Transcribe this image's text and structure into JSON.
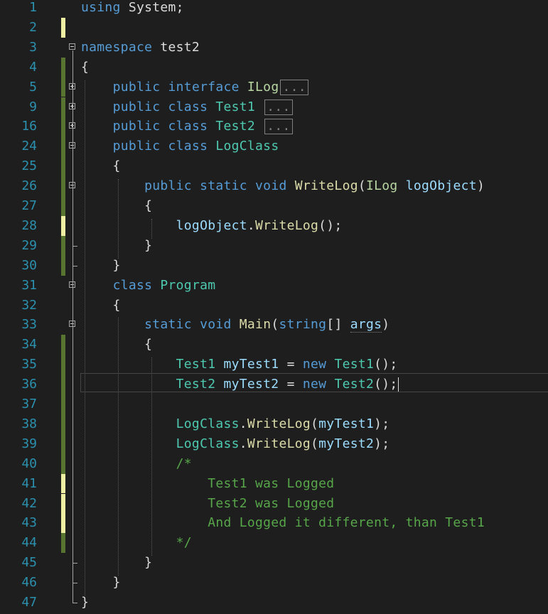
{
  "lines": [
    {
      "n": "1",
      "tokens": [
        [
          "kw",
          "using"
        ],
        [
          "pr",
          " System;"
        ]
      ]
    },
    {
      "n": "2",
      "tokens": []
    },
    {
      "n": "3",
      "tokens": [
        [
          "kw",
          "namespace"
        ],
        [
          "pr",
          " test2"
        ]
      ]
    },
    {
      "n": "4",
      "tokens": [
        [
          "pr",
          "{"
        ]
      ]
    },
    {
      "n": "5",
      "tokens": [
        [
          "pr",
          "    "
        ],
        [
          "kw",
          "public"
        ],
        [
          "pr",
          " "
        ],
        [
          "kw",
          "interface"
        ],
        [
          "pr",
          " "
        ],
        [
          "ty-i",
          "ILog"
        ]
      ],
      "collapsed": "..."
    },
    {
      "n": "9",
      "tokens": [
        [
          "pr",
          "    "
        ],
        [
          "kw",
          "public"
        ],
        [
          "pr",
          " "
        ],
        [
          "kw",
          "class"
        ],
        [
          "pr",
          " "
        ],
        [
          "ty",
          "Test1"
        ],
        [
          "pr",
          " "
        ]
      ],
      "collapsed": "..."
    },
    {
      "n": "16",
      "tokens": [
        [
          "pr",
          "    "
        ],
        [
          "kw",
          "public"
        ],
        [
          "pr",
          " "
        ],
        [
          "kw",
          "class"
        ],
        [
          "pr",
          " "
        ],
        [
          "ty",
          "Test2"
        ],
        [
          "pr",
          " "
        ]
      ],
      "collapsed": "..."
    },
    {
      "n": "24",
      "tokens": [
        [
          "pr",
          "    "
        ],
        [
          "kw",
          "public"
        ],
        [
          "pr",
          " "
        ],
        [
          "kw",
          "class"
        ],
        [
          "pr",
          " "
        ],
        [
          "ty",
          "LogClass"
        ]
      ]
    },
    {
      "n": "25",
      "tokens": [
        [
          "pr",
          "    {"
        ]
      ]
    },
    {
      "n": "26",
      "tokens": [
        [
          "pr",
          "        "
        ],
        [
          "kw",
          "public"
        ],
        [
          "pr",
          " "
        ],
        [
          "kw",
          "static"
        ],
        [
          "pr",
          " "
        ],
        [
          "kw",
          "void"
        ],
        [
          "pr",
          " "
        ],
        [
          "fn",
          "WriteLog"
        ],
        [
          "pr",
          "("
        ],
        [
          "ty-i",
          "ILog"
        ],
        [
          "pr",
          " "
        ],
        [
          "va",
          "logObject"
        ],
        [
          "pr",
          ")"
        ]
      ]
    },
    {
      "n": "27",
      "tokens": [
        [
          "pr",
          "        {"
        ]
      ]
    },
    {
      "n": "28",
      "tokens": [
        [
          "pr",
          "            "
        ],
        [
          "va",
          "logObject"
        ],
        [
          "pr",
          "."
        ],
        [
          "fn",
          "WriteLog"
        ],
        [
          "pr",
          "();"
        ]
      ]
    },
    {
      "n": "29",
      "tokens": [
        [
          "pr",
          "        }"
        ]
      ]
    },
    {
      "n": "30",
      "tokens": [
        [
          "pr",
          "    }"
        ]
      ]
    },
    {
      "n": "31",
      "tokens": [
        [
          "pr",
          "    "
        ],
        [
          "kw",
          "class"
        ],
        [
          "pr",
          " "
        ],
        [
          "ty",
          "Program"
        ]
      ]
    },
    {
      "n": "32",
      "tokens": [
        [
          "pr",
          "    {"
        ]
      ]
    },
    {
      "n": "33",
      "tokens": [
        [
          "pr",
          "        "
        ],
        [
          "kw",
          "static"
        ],
        [
          "pr",
          " "
        ],
        [
          "kw",
          "void"
        ],
        [
          "pr",
          " "
        ],
        [
          "fn",
          "Main"
        ],
        [
          "pr",
          "("
        ],
        [
          "kw",
          "string"
        ],
        [
          "pr",
          "[] "
        ],
        [
          "va squig",
          "args"
        ],
        [
          "pr",
          ")"
        ]
      ]
    },
    {
      "n": "34",
      "tokens": [
        [
          "pr",
          "        {"
        ]
      ]
    },
    {
      "n": "35",
      "tokens": [
        [
          "pr",
          "            "
        ],
        [
          "ty",
          "Test1"
        ],
        [
          "pr",
          " "
        ],
        [
          "va",
          "myTest1"
        ],
        [
          "pr",
          " = "
        ],
        [
          "kw",
          "new"
        ],
        [
          "pr",
          " "
        ],
        [
          "ty",
          "Test1"
        ],
        [
          "pr",
          "();"
        ]
      ]
    },
    {
      "n": "36",
      "tokens": [
        [
          "pr",
          "            "
        ],
        [
          "ty",
          "Test2"
        ],
        [
          "pr",
          " "
        ],
        [
          "va",
          "myTest2"
        ],
        [
          "pr",
          " = "
        ],
        [
          "kw",
          "new"
        ],
        [
          "pr",
          " "
        ],
        [
          "ty",
          "Test2"
        ],
        [
          "pr",
          "();"
        ]
      ],
      "caret": true
    },
    {
      "n": "37",
      "tokens": []
    },
    {
      "n": "38",
      "tokens": [
        [
          "pr",
          "            "
        ],
        [
          "ty",
          "LogClass"
        ],
        [
          "pr",
          "."
        ],
        [
          "fn",
          "WriteLog"
        ],
        [
          "pr",
          "("
        ],
        [
          "va",
          "myTest1"
        ],
        [
          "pr",
          ");"
        ]
      ]
    },
    {
      "n": "39",
      "tokens": [
        [
          "pr",
          "            "
        ],
        [
          "ty",
          "LogClass"
        ],
        [
          "pr",
          "."
        ],
        [
          "fn",
          "WriteLog"
        ],
        [
          "pr",
          "("
        ],
        [
          "va",
          "myTest2"
        ],
        [
          "pr",
          ");"
        ]
      ]
    },
    {
      "n": "40",
      "tokens": [
        [
          "pr",
          "            "
        ],
        [
          "cm",
          "/*"
        ]
      ]
    },
    {
      "n": "41",
      "tokens": [
        [
          "cm",
          "                Test1 was Logged"
        ]
      ]
    },
    {
      "n": "42",
      "tokens": [
        [
          "cm",
          "                Test2 was Logged"
        ]
      ]
    },
    {
      "n": "43",
      "tokens": [
        [
          "cm",
          "                And Logged it different, than Test1"
        ]
      ]
    },
    {
      "n": "44",
      "tokens": [
        [
          "cm",
          "            */"
        ]
      ]
    },
    {
      "n": "45",
      "tokens": [
        [
          "pr",
          "        }"
        ]
      ]
    },
    {
      "n": "46",
      "tokens": [
        [
          "pr",
          "    }"
        ]
      ]
    },
    {
      "n": "47",
      "tokens": [
        [
          "pr",
          "}"
        ]
      ]
    }
  ],
  "colors": {
    "background": "#1e1e1e",
    "line_number": "#2b91af",
    "keyword": "#569cd6",
    "type": "#4ec9b0",
    "interface": "#b8d7a3",
    "method": "#dcdcaa",
    "variable": "#9cdcfe",
    "comment": "#57a64a",
    "change_saved": "#577430",
    "change_unsaved": "#efefa3"
  }
}
